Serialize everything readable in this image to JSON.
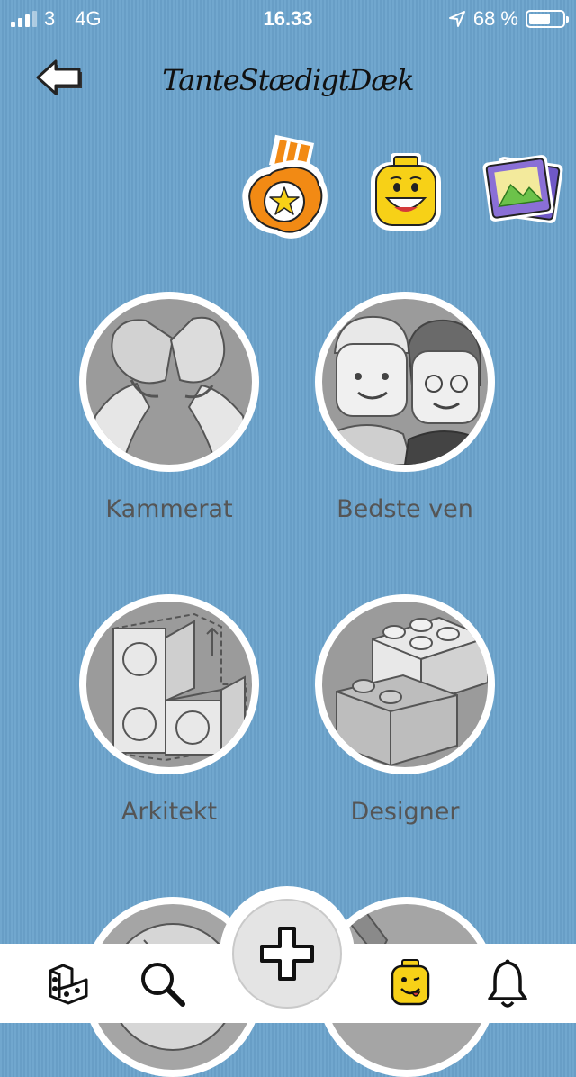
{
  "status_bar": {
    "carrier": "3",
    "network": "4G",
    "time": "16.33",
    "battery_percent": "68 %",
    "battery_level": 0.68
  },
  "header": {
    "title": "TanteStædigtDæk",
    "back_icon": "back-arrow-icon"
  },
  "stickers": [
    {
      "name": "badge-sticker",
      "icon": "star-badge-icon"
    },
    {
      "name": "minifig-face-sticker",
      "icon": "smiley-minifig-icon"
    },
    {
      "name": "photos-sticker",
      "icon": "photo-gallery-icon"
    }
  ],
  "categories": [
    {
      "label": "Kammerat"
    },
    {
      "label": "Bedste ven"
    },
    {
      "label": "Arkitekt"
    },
    {
      "label": "Designer"
    }
  ],
  "tab_bar": {
    "items": [
      "bricks-icon",
      "search-icon",
      "add-icon",
      "minifig-profile-icon",
      "bell-icon"
    ]
  },
  "colors": {
    "background": "#6ba3cc",
    "badge_orange": "#f28a14",
    "minifig_yellow": "#f7d117",
    "photos_purple": "#8a6fd6"
  }
}
